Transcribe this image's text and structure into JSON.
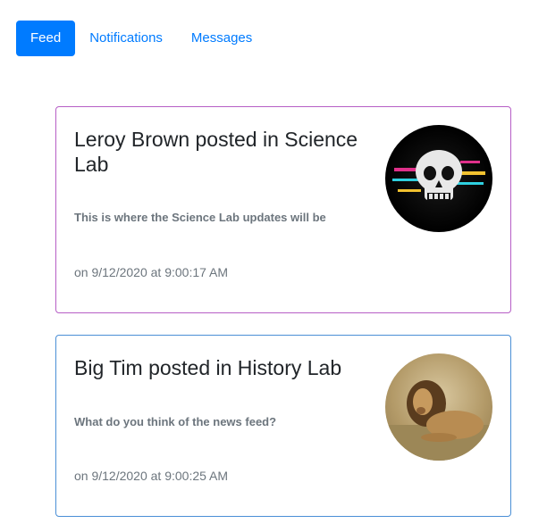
{
  "nav": {
    "tabs": [
      {
        "label": "Feed",
        "active": true
      },
      {
        "label": "Notifications",
        "active": false
      },
      {
        "label": "Messages",
        "active": false
      }
    ]
  },
  "posts": [
    {
      "title": "Leroy Brown posted in Science Lab",
      "body": "This is where the Science Lab updates will be",
      "date": "on 9/12/2020 at 9:00:17 AM",
      "avatar_icon": "skull-avatar",
      "border_color": "#b65ec6"
    },
    {
      "title": "Big Tim posted in History Lab",
      "body": "What do you think of the news feed?",
      "date": "on 9/12/2020 at 9:00:25 AM",
      "avatar_icon": "lion-avatar",
      "border_color": "#4a8fd6"
    }
  ],
  "colors": {
    "primary": "#007bff",
    "muted": "#6c757d"
  }
}
